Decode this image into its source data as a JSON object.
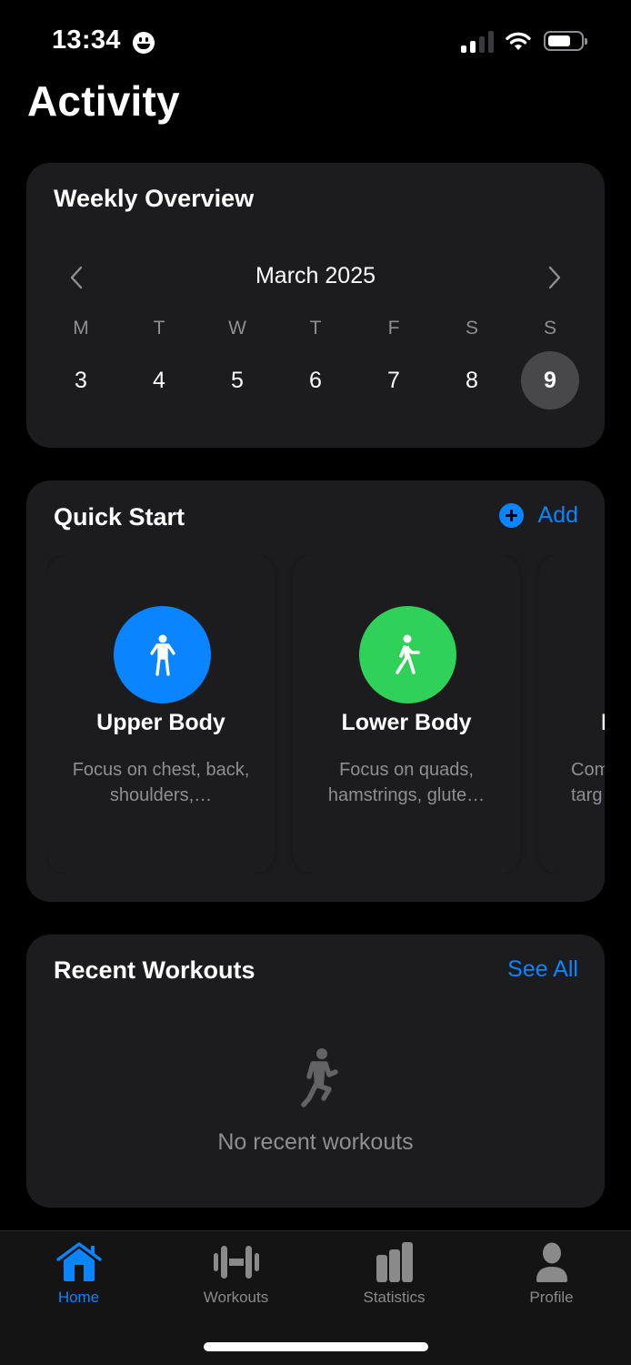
{
  "status_bar": {
    "time": "13:34",
    "focus_icon": "grinning-face-icon",
    "signal_bars_active": 2,
    "signal_bars_total": 4,
    "wifi_icon": "wifi-icon",
    "battery_level": 0.72
  },
  "page": {
    "title": "Activity"
  },
  "colors": {
    "accent": "#0a84ff",
    "card_bg": "#1c1c1e",
    "secondary_text": "#8e8e93",
    "today_bg": "#48484a",
    "upper_body": "#0a84ff",
    "lower_body": "#30d158"
  },
  "weekly_overview": {
    "title": "Weekly Overview",
    "month": "March 2025",
    "prev_icon": "chevron-left-icon",
    "next_icon": "chevron-right-icon",
    "days": [
      {
        "dow": "M",
        "date": "3",
        "today": false
      },
      {
        "dow": "T",
        "date": "4",
        "today": false
      },
      {
        "dow": "W",
        "date": "5",
        "today": false
      },
      {
        "dow": "T",
        "date": "6",
        "today": false
      },
      {
        "dow": "F",
        "date": "7",
        "today": false
      },
      {
        "dow": "S",
        "date": "8",
        "today": false
      },
      {
        "dow": "S",
        "date": "9",
        "today": true
      }
    ]
  },
  "quick_start": {
    "title": "Quick Start",
    "add_label": "Add",
    "add_icon": "plus-circle-icon",
    "items": [
      {
        "name": "Upper Body",
        "description": "Focus on chest, back, shoulders,…",
        "icon": "standing-figure-icon",
        "color": "#0a84ff"
      },
      {
        "name": "Lower Body",
        "description": "Focus on quads, hamstrings, glute…",
        "icon": "walking-figure-icon",
        "color": "#30d158"
      },
      {
        "name": "F",
        "description": "Com targ",
        "icon": "",
        "color": ""
      }
    ]
  },
  "recent_workouts": {
    "title": "Recent Workouts",
    "see_all_label": "See All",
    "empty_icon": "running-figure-icon",
    "empty_text": "No recent workouts"
  },
  "tab_bar": {
    "tabs": [
      {
        "label": "Home",
        "icon": "house-icon",
        "active": true
      },
      {
        "label": "Workouts",
        "icon": "dumbbell-icon",
        "active": false
      },
      {
        "label": "Statistics",
        "icon": "bar-chart-icon",
        "active": false
      },
      {
        "label": "Profile",
        "icon": "person-icon",
        "active": false
      }
    ]
  }
}
